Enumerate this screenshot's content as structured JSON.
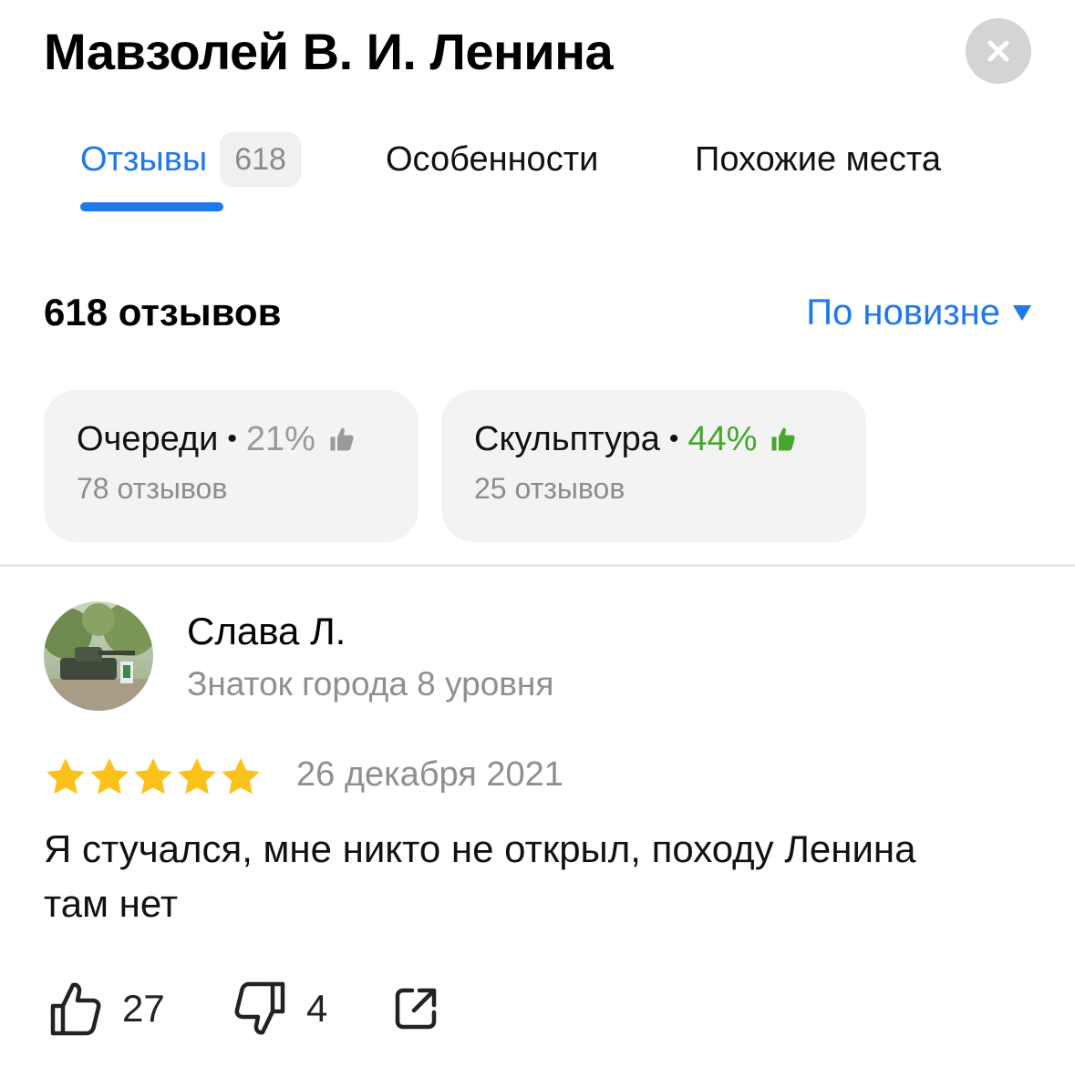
{
  "header": {
    "title": "Мавзолей В. И. Ленина",
    "close_icon": "close-icon"
  },
  "tabs": [
    {
      "label": "Отзывы",
      "count": "618",
      "active": true
    },
    {
      "label": "Особенности",
      "active": false
    },
    {
      "label": "Похожие места",
      "active": false
    }
  ],
  "reviews_summary": {
    "total_label": "618 отзывов",
    "sort_label": "По новизне"
  },
  "aspects": [
    {
      "name": "Очереди",
      "percent": "21%",
      "reviews": "78 отзывов",
      "thumb_color": "#9a9a9a",
      "icon": "thumb-up-icon"
    },
    {
      "name": "Скульптура",
      "percent": "44%",
      "reviews": "25 отзывов",
      "thumb_color": "#43a82c",
      "icon": "thumb-up-icon"
    }
  ],
  "review": {
    "author": "Слава Л.",
    "level": "Знаток города 8 уровня",
    "rating": 5,
    "rating_max": 5,
    "date": "26 декабря 2021",
    "text": "Я стучался, мне никто не открыл, походу Ленина там нет",
    "likes": "27",
    "dislikes": "4"
  },
  "colors": {
    "accent": "#1e78f0",
    "star": "#fcc21b",
    "positive": "#43a82c",
    "muted": "#8f8f8f"
  }
}
